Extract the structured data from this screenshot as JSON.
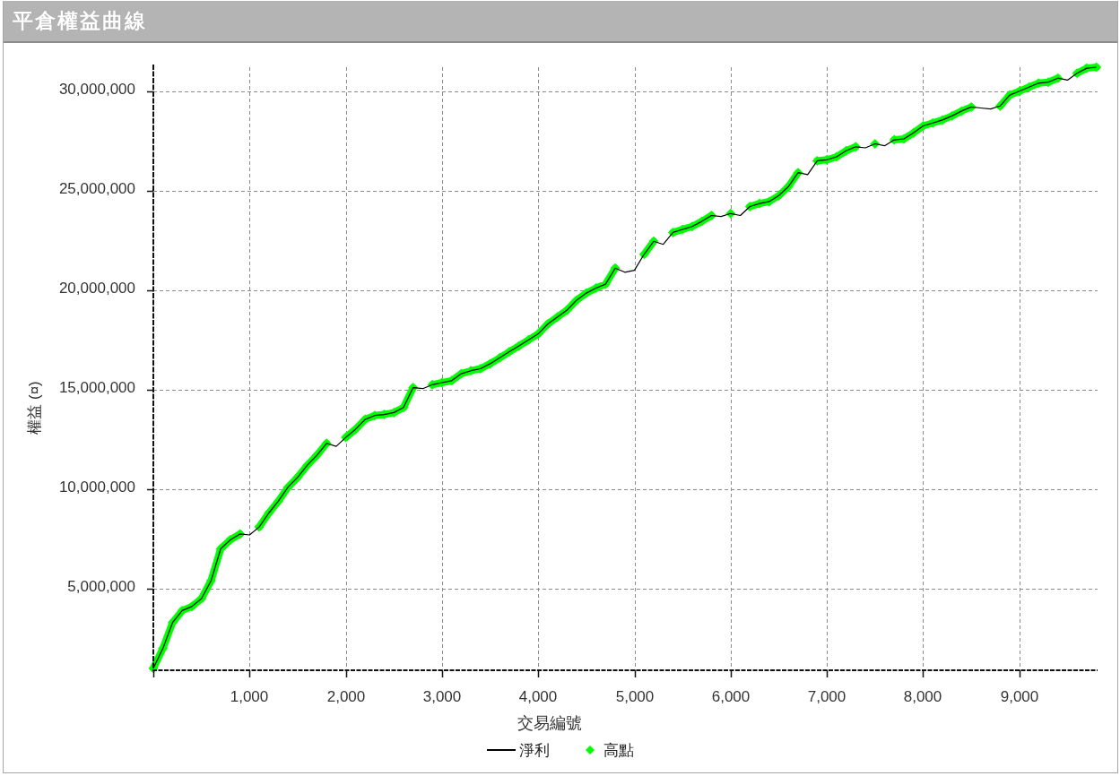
{
  "panel": {
    "title": "平倉權益曲線"
  },
  "chart": {
    "chart_data": {
      "type": "line",
      "xlabel": "交易編號",
      "ylabel": "權益 (¤)",
      "grid": true,
      "x": [
        0,
        100,
        200,
        300,
        400,
        500,
        600,
        700,
        800,
        900,
        1000,
        1100,
        1200,
        1300,
        1400,
        1500,
        1600,
        1700,
        1800,
        1900,
        2000,
        2100,
        2200,
        2300,
        2400,
        2500,
        2600,
        2700,
        2800,
        2900,
        3000,
        3100,
        3200,
        3300,
        3400,
        3500,
        3600,
        3700,
        3800,
        3900,
        4000,
        4100,
        4200,
        4300,
        4400,
        4500,
        4600,
        4700,
        4800,
        4900,
        5000,
        5100,
        5200,
        5300,
        5400,
        5500,
        5600,
        5700,
        5800,
        5900,
        6000,
        6100,
        6200,
        6300,
        6400,
        6500,
        6600,
        6700,
        6800,
        6900,
        7000,
        7100,
        7200,
        7300,
        7400,
        7500,
        7600,
        7700,
        7800,
        7900,
        8000,
        8100,
        8200,
        8300,
        8400,
        8500,
        8600,
        8700,
        8800,
        8900,
        9000,
        9100,
        9200,
        9300,
        9400,
        9500,
        9600,
        9700,
        9800
      ],
      "series": [
        {
          "name": "淨利",
          "color": "#000000",
          "values": [
            1000000,
            2000000,
            3300000,
            3900000,
            4100000,
            4500000,
            5400000,
            7000000,
            7450000,
            7750000,
            7700000,
            8100000,
            8800000,
            9400000,
            10100000,
            10600000,
            11200000,
            11700000,
            12300000,
            12150000,
            12600000,
            13000000,
            13500000,
            13700000,
            13750000,
            13850000,
            14100000,
            15100000,
            15050000,
            15250000,
            15350000,
            15450000,
            15800000,
            15950000,
            16050000,
            16300000,
            16600000,
            16900000,
            17200000,
            17500000,
            17800000,
            18300000,
            18650000,
            19000000,
            19500000,
            19850000,
            20100000,
            20300000,
            21100000,
            20900000,
            21000000,
            21800000,
            22450000,
            22300000,
            22900000,
            23050000,
            23200000,
            23450000,
            23750000,
            23700000,
            23850000,
            23750000,
            24200000,
            24350000,
            24450000,
            24750000,
            25200000,
            25900000,
            25800000,
            26500000,
            26550000,
            26700000,
            27000000,
            27200000,
            27150000,
            27350000,
            27250000,
            27550000,
            27600000,
            27900000,
            28250000,
            28400000,
            28550000,
            28750000,
            29000000,
            29200000,
            29150000,
            29100000,
            29250000,
            29800000,
            30000000,
            30200000,
            30400000,
            30450000,
            30650000,
            30550000,
            30900000,
            31150000,
            31200000
          ]
        },
        {
          "name": "高點",
          "color": "#00ff00",
          "marker": "diamond",
          "values": [
            1000000,
            2000000,
            3300000,
            3900000,
            4100000,
            4500000,
            5400000,
            7000000,
            7450000,
            7750000,
            null,
            8100000,
            8800000,
            9400000,
            10100000,
            10600000,
            11200000,
            11700000,
            12300000,
            null,
            12600000,
            13000000,
            13500000,
            13700000,
            13750000,
            13850000,
            14100000,
            15100000,
            null,
            15250000,
            15350000,
            15450000,
            15800000,
            15950000,
            16050000,
            16300000,
            16600000,
            16900000,
            17200000,
            17500000,
            17800000,
            18300000,
            18650000,
            19000000,
            19500000,
            19850000,
            20100000,
            20300000,
            21100000,
            null,
            null,
            21800000,
            22450000,
            null,
            22900000,
            23050000,
            23200000,
            23450000,
            23750000,
            null,
            23850000,
            null,
            24200000,
            24350000,
            24450000,
            24750000,
            25200000,
            25900000,
            null,
            26500000,
            26550000,
            26700000,
            27000000,
            27200000,
            null,
            27350000,
            null,
            27550000,
            27600000,
            27900000,
            28250000,
            28400000,
            28550000,
            28750000,
            29000000,
            29200000,
            null,
            null,
            29250000,
            29800000,
            30000000,
            30200000,
            30400000,
            30450000,
            30650000,
            null,
            30900000,
            31150000,
            31200000
          ]
        }
      ],
      "xlim": [
        0,
        9813
      ],
      "ylim": [
        900000,
        31200000
      ],
      "xticks": [
        {
          "value": 1000,
          "label": "1,000"
        },
        {
          "value": 2000,
          "label": "2,000"
        },
        {
          "value": 3000,
          "label": "3,000"
        },
        {
          "value": 4000,
          "label": "4,000"
        },
        {
          "value": 5000,
          "label": "5,000"
        },
        {
          "value": 6000,
          "label": "6,000"
        },
        {
          "value": 7000,
          "label": "7,000"
        },
        {
          "value": 8000,
          "label": "8,000"
        },
        {
          "value": 9000,
          "label": "9,000"
        }
      ],
      "yticks": [
        {
          "value": 5000000,
          "label": "5,000,000"
        },
        {
          "value": 10000000,
          "label": "10,000,000"
        },
        {
          "value": 15000000,
          "label": "15,000,000"
        },
        {
          "value": 20000000,
          "label": "20,000,000"
        },
        {
          "value": 25000000,
          "label": "25,000,000"
        },
        {
          "value": 30000000,
          "label": "30,000,000"
        }
      ]
    }
  }
}
